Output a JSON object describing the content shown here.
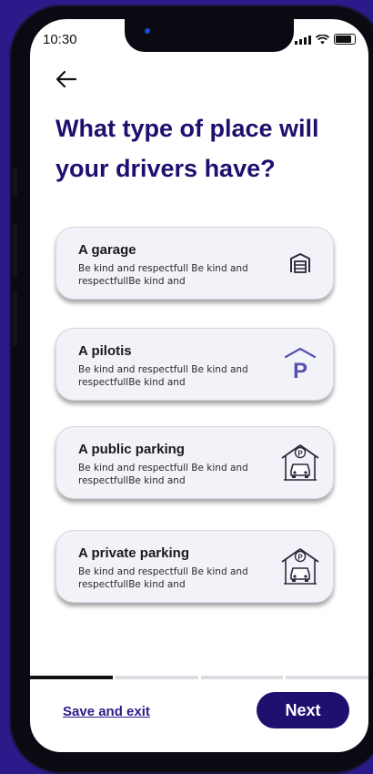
{
  "status_bar": {
    "time": "10:30"
  },
  "page": {
    "title": "What type of place will your drivers have?"
  },
  "options": [
    {
      "title": "A garage",
      "description": "Be kind and respectfull Be kind and respectfullBe kind and",
      "icon": "garage-door-icon"
    },
    {
      "title": "A pilotis",
      "description": "Be kind and respectfull Be kind and respectfullBe kind and",
      "icon": "covered-parking-icon"
    },
    {
      "title": "A public parking",
      "description": "Be kind and respectfull Be kind and respectfullBe kind and",
      "icon": "public-parking-car-icon"
    },
    {
      "title": "A private parking",
      "description": "Be kind and respectfull Be kind and respectfullBe kind and",
      "icon": "private-parking-car-icon"
    }
  ],
  "progress": {
    "step": 1,
    "total": 4
  },
  "footer": {
    "save_label": "Save and exit",
    "next_label": "Next"
  },
  "colors": {
    "primary": "#1f1070",
    "title": "#1d0f6e",
    "background": "#2a1a8a"
  }
}
